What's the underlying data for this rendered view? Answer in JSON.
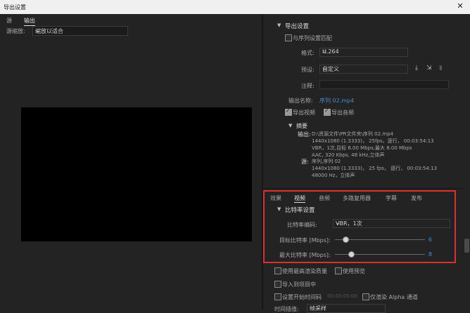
{
  "window": {
    "title": "导出设置",
    "close_glyph": "✕"
  },
  "left": {
    "tabs": [
      "源",
      "输出"
    ],
    "scale_label": "源缩放:",
    "scale_value": "缩放以适合"
  },
  "export": {
    "section_title": "导出设置",
    "match_sequence": "与序列设置匹配",
    "format_label": "格式:",
    "format_value": "H.264",
    "preset_label": "预设:",
    "preset_value": "自定义",
    "comment_label": "注释:",
    "output_name_label": "输出名称:",
    "output_name_value": "序列 02.mp4",
    "export_video": "导出视频",
    "export_audio": "导出音频"
  },
  "summary": {
    "title": "摘要",
    "output_label": "输出:",
    "output_lines": [
      "D:\\资源文件\\PR文件夹\\序列 02.mp4",
      "1440x1080 (1.3333)， 25fps，逐行， 00:03:54:13",
      "VBR，1次,目标 6.00 Mbps,最大 8.00 Mbps",
      "AAC, 320 Kbps, 48 kHz,立体声"
    ],
    "source_label": "源:",
    "source_lines": [
      "序列,序列 02",
      "1440x1080 (1.3333)， 25 fps， 逐行， 00:03:54:13",
      "48000 Hz，立体声"
    ]
  },
  "tabs": {
    "effects": "效果",
    "video": "视频",
    "audio": "音频",
    "multiplexer": "多路复用器",
    "captions": "字幕",
    "publish": "发布"
  },
  "bitrate": {
    "title": "比特率设置",
    "encoding_label": "比特率编码:",
    "encoding_value": "VBR，1次",
    "target_label": "目标比特率 [Mbps]:",
    "target_value": "6",
    "target_fraction": 0.12,
    "max_label": "最大比特率 [Mbps]:",
    "max_value": "8",
    "max_fraction": 0.18
  },
  "bottom": {
    "max_render_quality": "使用最高渲染质量",
    "use_previews": "使用预览",
    "import_into_project": "导入到项目中",
    "set_start_timecode": "设置开始时间码",
    "timecode_value": "00:00:00:00",
    "render_alpha": "仅渲染 Alpha 通道",
    "interp_label": "时间插值:",
    "interp_value": "帧采样"
  },
  "colors": {
    "accent_link": "#3d8edb",
    "highlight_box": "#d8332a"
  },
  "icons": [
    "save-preset-icon",
    "import-preset-icon",
    "delete-preset-icon"
  ]
}
